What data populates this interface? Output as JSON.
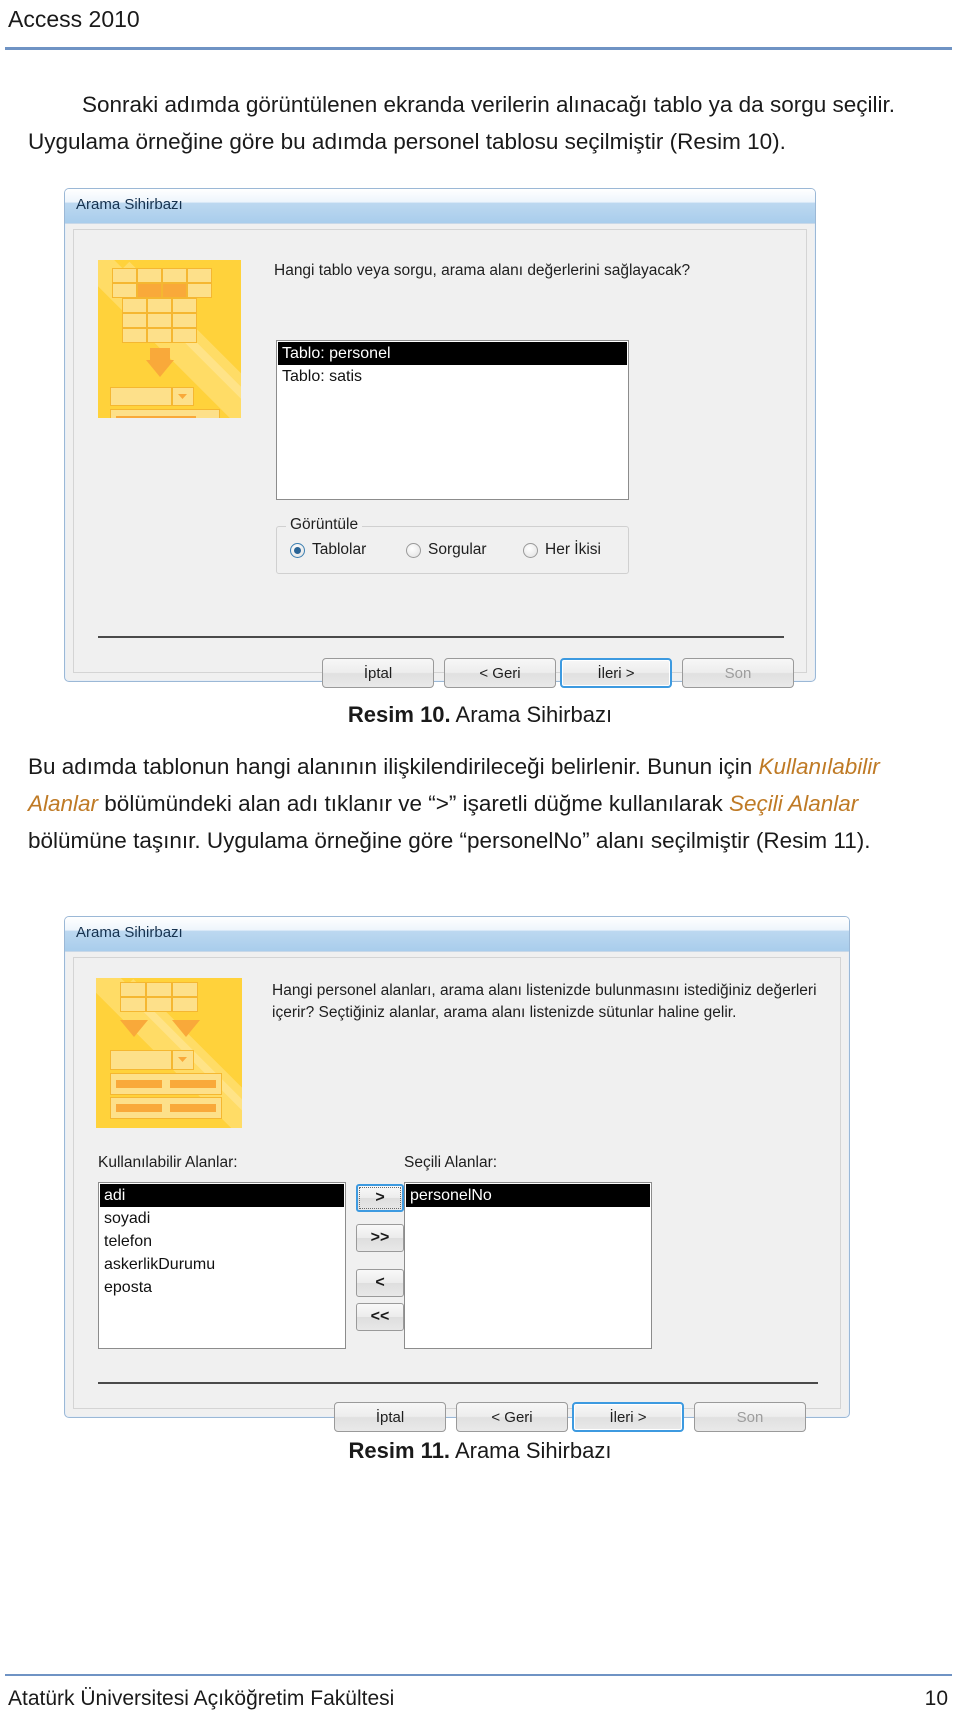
{
  "header": {
    "title": "Access 2010"
  },
  "paragraphs": {
    "p1_a": "Sonraki adımda görüntülenen ekranda verilerin alınacağı tablo ya da sorgu seçilir. Uygulama örneğine göre bu adımda personel tablosu seçilmiştir (Resim 10).",
    "p2_a": "Bu adımda tablonun hangi alanının ilişkilendirileceği belirlenir. Bunun için ",
    "p2_hl1": "Kullanılabilir Alanlar",
    "p2_b": " bölümündeki alan adı tıklanır ve “>” işaretli düğme kullanılarak ",
    "p2_hl2": "Seçili Alanlar",
    "p2_c": " bölümüne taşınır. Uygulama örneğine göre “personelNo” alanı seçilmiştir (Resim 11)."
  },
  "captions": {
    "fig10_num": "Resim 10.",
    "fig10_text": " Arama Sihirbazı",
    "fig11_num": "Resim 11.",
    "fig11_text": " Arama Sihirbazı"
  },
  "dialog1": {
    "title": "Arama Sihirbazı",
    "prompt": "Hangi tablo veya sorgu, arama alanı değerlerini sağlayacak?",
    "list_items": [
      {
        "label": "Tablo: personel",
        "selected": true
      },
      {
        "label": "Tablo: satis",
        "selected": false
      }
    ],
    "group_legend": "Görüntüle",
    "radios": [
      {
        "label": "Tablolar",
        "accel": "T",
        "selected": true
      },
      {
        "label": "Sorgular",
        "accel": "S",
        "selected": false
      },
      {
        "label": "Her İkisi",
        "accel": "H",
        "selected": false
      }
    ],
    "buttons": [
      {
        "label": "İptal",
        "state": "normal"
      },
      {
        "label": "< Geri",
        "state": "normal"
      },
      {
        "label": "İleri >",
        "state": "focused"
      },
      {
        "label": "Son",
        "state": "disabled"
      }
    ]
  },
  "dialog2": {
    "title": "Arama Sihirbazı",
    "prompt_line1": "Hangi personel alanları, arama alanı listenizde bulunmasını istediğiniz değerleri",
    "prompt_line2": "içerir? Seçtiğiniz alanlar, arama alanı listenizde sütunlar haline gelir.",
    "available_label": "Kullanılabilir Alanlar:",
    "selected_label": "Seçili Alanlar:",
    "available_items": [
      {
        "label": "adi",
        "selected": true
      },
      {
        "label": "soyadi",
        "selected": false
      },
      {
        "label": "telefon",
        "selected": false
      },
      {
        "label": "askerlikDurumu",
        "selected": false
      },
      {
        "label": "eposta",
        "selected": false
      }
    ],
    "selected_items": [
      {
        "label": "personelNo",
        "selected": true
      }
    ],
    "transfer_buttons": [
      {
        "label": ">",
        "state": "focused"
      },
      {
        "label": ">>",
        "state": "normal"
      },
      {
        "label": "<",
        "state": "normal"
      },
      {
        "label": "<<",
        "state": "normal"
      }
    ],
    "buttons": [
      {
        "label": "İptal",
        "state": "normal"
      },
      {
        "label": "< Geri",
        "state": "normal"
      },
      {
        "label": "İleri >",
        "state": "focused"
      },
      {
        "label": "Son",
        "state": "disabled"
      }
    ]
  },
  "footer": {
    "institution": "Atatürk Üniversitesi Açıköğretim Fakültesi",
    "page_number": "10"
  },
  "colors": {
    "accent_rule": "#6f93c4",
    "highlight_text": "#bf7a25",
    "wizard_art": "#ffd23b",
    "focus_border": "#3d9ae0"
  }
}
